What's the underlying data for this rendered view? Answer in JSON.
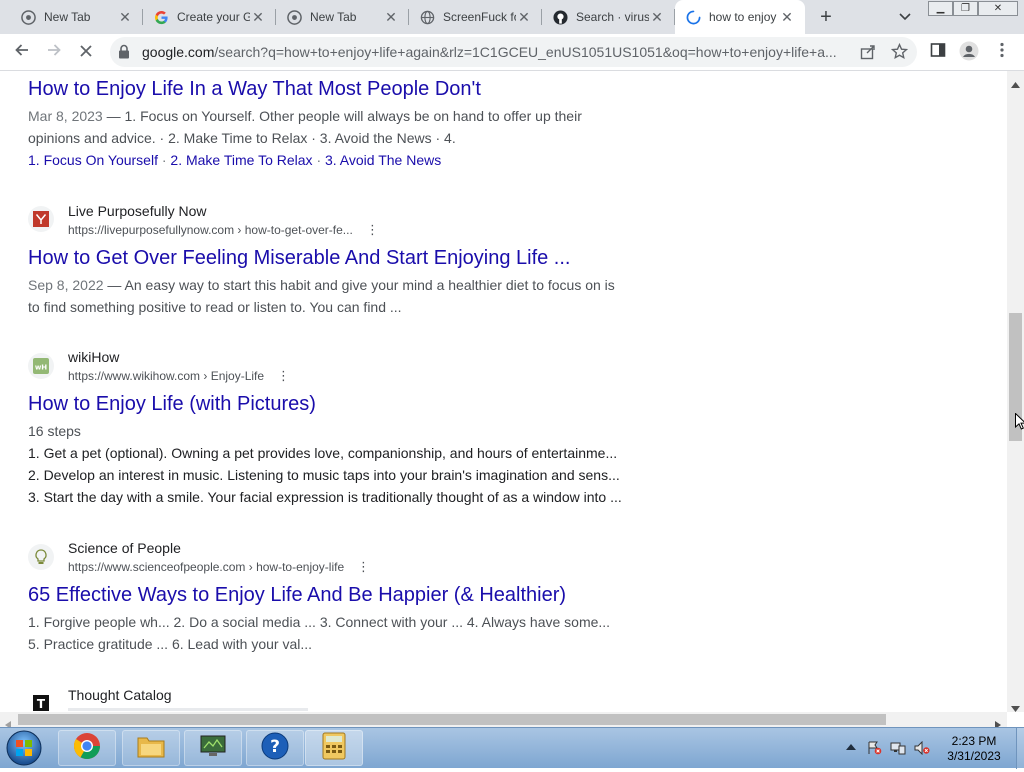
{
  "browser": {
    "tabs": [
      {
        "title": "New Tab",
        "icon": "chrome-icon",
        "active": false
      },
      {
        "title": "Create your G",
        "icon": "google-icon",
        "active": false
      },
      {
        "title": "New Tab",
        "icon": "chrome-icon",
        "active": false
      },
      {
        "title": "ScreenFuck fo",
        "icon": "globe-icon",
        "active": false
      },
      {
        "title": "Search · virus",
        "icon": "github-icon",
        "active": false
      },
      {
        "title": "how to enjoy",
        "icon": "loading-spinner-icon",
        "active": true
      }
    ],
    "new_tab_label": "+",
    "url_host": "google.com",
    "url_rest": "/search?q=how+to+enjoy+life+again&rlz=1C1GCEU_enUS1051US1051&oq=how+to+enjoy+life+a..."
  },
  "results": [
    {
      "title": "How to Enjoy Life In a Way That Most People Don't",
      "date": "Mar 8, 2023",
      "snippet_line1": " — 1. Focus on Yourself. Other people will always be on hand to offer up their",
      "snippet_line2": "opinions and advice. · 2. Make Time to Relax · 3. Avoid the News · 4.",
      "sublinks": [
        "1. Focus On Yourself",
        "2. Make Time To Relax",
        "3. Avoid The News"
      ]
    },
    {
      "site": "Live Purposefully Now",
      "url": "https://livepurposefullynow.com › how-to-get-over-fe...",
      "title": "How to Get Over Feeling Miserable And Start Enjoying Life ...",
      "date": "Sep 8, 2022",
      "snippet_line1": " — An easy way to start this habit and give your mind a healthier diet to focus on is",
      "snippet_line2": "to find something positive to read or listen to. You can find ..."
    },
    {
      "site": "wikiHow",
      "url": "https://www.wikihow.com › Enjoy-Life",
      "title": "How to Enjoy Life (with Pictures)",
      "meta": "16 steps",
      "steps": [
        "1.   Get a pet (optional). Owning a pet provides love, companionship, and hours of entertainme...",
        "2.   Develop an interest in music. Listening to music taps into your brain's imagination and sens...",
        "3.   Start the day with a smile. Your facial expression is traditionally thought of as a window into ..."
      ]
    },
    {
      "site": "Science of People",
      "url": "https://www.scienceofpeople.com › how-to-enjoy-life",
      "title": "65 Effective Ways to Enjoy Life And Be Happier (& Healthier)",
      "snippet_line1": "1. Forgive people wh...   2. Do a social media ...   3. Connect with your ...   4. Always have some...",
      "snippet_line2": "5. Practice gratitude ...   6. Lead with your val..."
    },
    {
      "site": "Thought Catalog",
      "favicon_letter": "T"
    }
  ],
  "taskbar": {
    "clock_time": "2:23 PM",
    "clock_date": "3/31/2023"
  }
}
